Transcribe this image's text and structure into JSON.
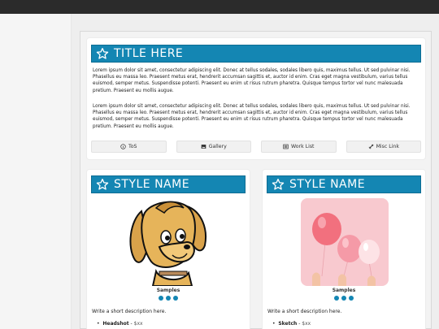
{
  "header": {
    "title": "TITLE HERE"
  },
  "paragraphs": [
    "Lorem ipsum dolor sit amet, consectetur adipiscing elit. Donec at tellus sodales, sodales libero quis, maximus tellus. Ut sed pulvinar nisi. Phasellus eu massa leo. Praesent metus erat, hendrerit accumsan sagittis et, auctor id enim. Cras eget magna vestibulum, varius tellus euismod, semper metus. Suspendisse potenti. Praesent eu enim ut risus rutrum pharetra. Quisque tempus tortor vel nunc malesuada pretium. Praesent eu mollis augue.",
    "Lorem ipsum dolor sit amet, consectetur adipiscing elit. Donec at tellus sodales, sodales libero quis, maximus tellus. Ut sed pulvinar nisi. Phasellus eu massa leo. Praesent metus erat, hendrerit accumsan sagittis et, auctor id enim. Cras eget magna vestibulum, varius tellus euismod, semper metus. Suspendisse potenti. Praesent eu enim ut risus rutrum pharetra. Quisque tempus tortor vel nunc malesuada pretium. Praesent eu mollis augue."
  ],
  "buttons": [
    {
      "label": "ToS",
      "icon": "info-icon"
    },
    {
      "label": "Gallery",
      "icon": "image-icon"
    },
    {
      "label": "Work List",
      "icon": "list-icon"
    },
    {
      "label": "Misc Link",
      "icon": "link-icon"
    }
  ],
  "styles": [
    {
      "title": "STYLE NAME",
      "image": "cartoon-dog-image",
      "samples_label": "Samples",
      "description": "Write a short description here.",
      "item_name": "Headshot",
      "item_price": "$xx"
    },
    {
      "title": "STYLE NAME",
      "image": "pink-balloons-image",
      "samples_label": "Samples",
      "description": "Write a short description here.",
      "item_name": "Sketch",
      "item_price": "$xx"
    }
  ],
  "colors": {
    "accent": "#1486b3",
    "topbar": "#2b2b2b",
    "background": "#eeeeee"
  }
}
